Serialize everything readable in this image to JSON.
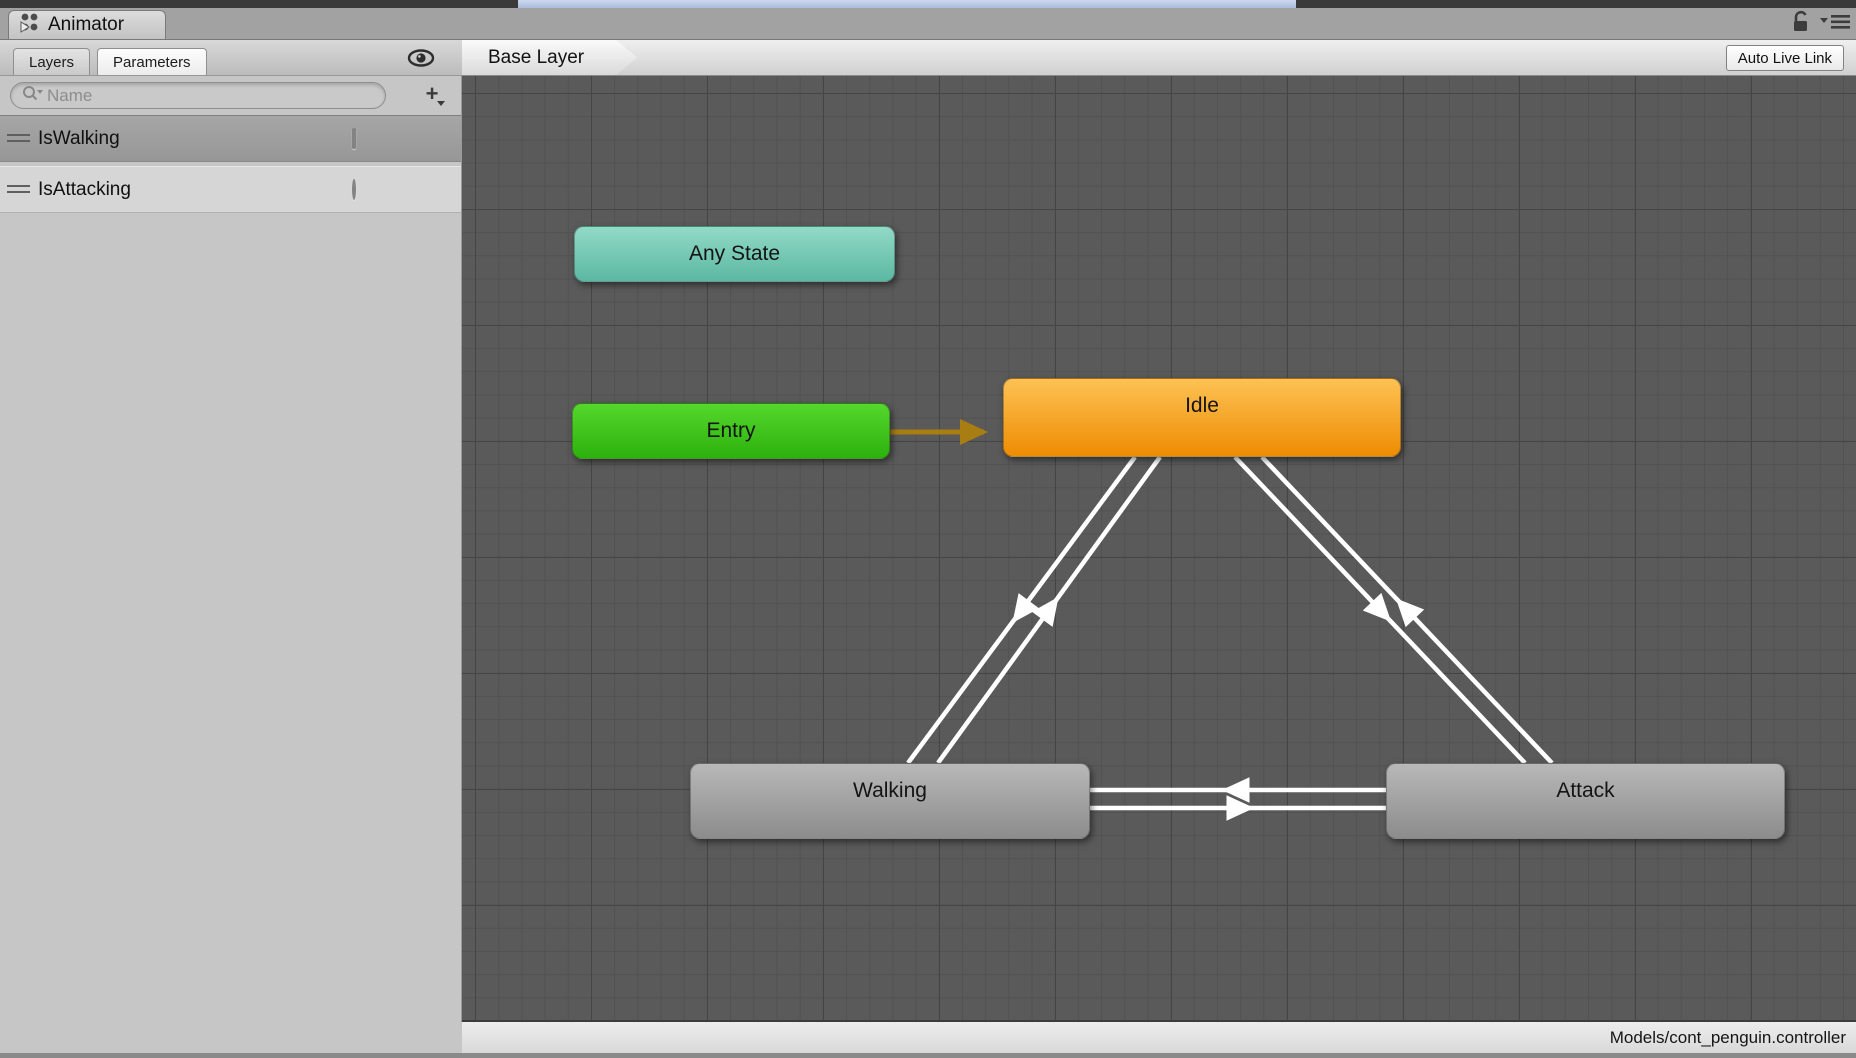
{
  "window": {
    "tab_title": "Animator",
    "controls": [
      "lock",
      "menu"
    ]
  },
  "left_panel": {
    "tabs": [
      {
        "label": "Layers",
        "active": false
      },
      {
        "label": "Parameters",
        "active": true
      }
    ],
    "search_placeholder": "Name",
    "add_button_label": "+",
    "parameters": [
      {
        "name": "IsWalking",
        "control": "checkbox",
        "checked": false,
        "selected": true
      },
      {
        "name": "IsAttacking",
        "control": "radio",
        "checked": false,
        "selected": false
      }
    ]
  },
  "canvas": {
    "breadcrumb": "Base Layer",
    "auto_live_link_label": "Auto Live Link",
    "nodes": [
      {
        "label": "Any State",
        "kind": "any-state",
        "color_top": "#92dac6",
        "color_bottom": "#5cb8a2"
      },
      {
        "label": "Entry",
        "kind": "entry",
        "color_top": "#55d72c",
        "color_bottom": "#2db10d"
      },
      {
        "label": "Idle",
        "kind": "default-state",
        "color_top": "#fdc254",
        "color_bottom": "#ee8c03"
      },
      {
        "label": "Walking",
        "kind": "state",
        "color_top": "#b8b8b8",
        "color_bottom": "#8c8c8c"
      },
      {
        "label": "Attack",
        "kind": "state",
        "color_top": "#b8b8b8",
        "color_bottom": "#8c8c8c"
      }
    ],
    "transitions": [
      {
        "from": "Entry",
        "to": "Idle",
        "color": "#a87e12"
      },
      {
        "from": "Idle",
        "to": "Walking",
        "color": "#ffffff"
      },
      {
        "from": "Walking",
        "to": "Idle",
        "color": "#ffffff"
      },
      {
        "from": "Idle",
        "to": "Attack",
        "color": "#ffffff"
      },
      {
        "from": "Attack",
        "to": "Idle",
        "color": "#ffffff"
      },
      {
        "from": "Walking",
        "to": "Attack",
        "color": "#ffffff"
      },
      {
        "from": "Attack",
        "to": "Walking",
        "color": "#ffffff"
      }
    ],
    "background_color": "#5a5a5a",
    "grid_minor_color": "#525252",
    "grid_major_color": "#454545"
  },
  "status_bar": {
    "path": "Models/cont_penguin.controller"
  }
}
